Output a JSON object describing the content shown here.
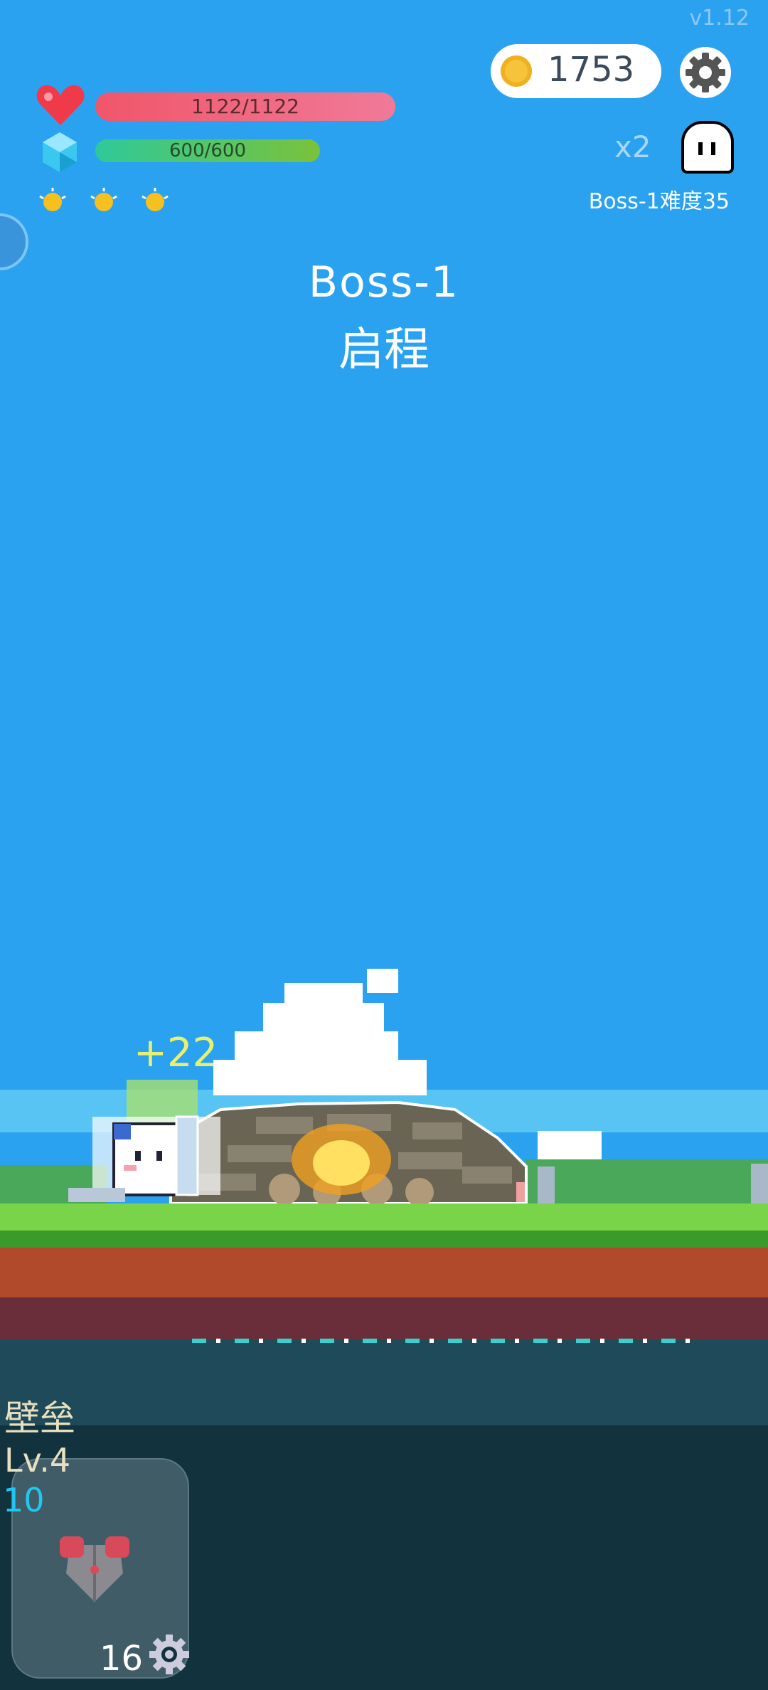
{
  "version": "v1.12",
  "coins": {
    "value": "1753",
    "icon": "coin-icon"
  },
  "settings": {
    "icon": "gear-icon"
  },
  "player": {
    "hp_text": "1122/1122",
    "hp_fraction": 1.0,
    "mp_text": "600/600",
    "mp_fraction": 1.0,
    "buff_icons": [
      "sun-icon",
      "sun-icon",
      "sun-icon"
    ]
  },
  "boss_info": {
    "multiplier": "x2",
    "difficulty": "Boss-1难度35",
    "icon": "ghost-icon"
  },
  "stage": {
    "name": "Boss-1",
    "subtitle": "启程"
  },
  "combat": {
    "floating_number": "+22"
  },
  "skill": {
    "name": "壁垒",
    "level": "Lv.4",
    "value": "10",
    "count": "16",
    "icon": "armor-icon",
    "cooldown_icon": "gear-icon"
  },
  "colors": {
    "sky": "#2aa2f0",
    "hp": "#f0566a",
    "mp": "#2ec99a",
    "grass": "#7ad44a",
    "dirt": "#b04a2a"
  }
}
